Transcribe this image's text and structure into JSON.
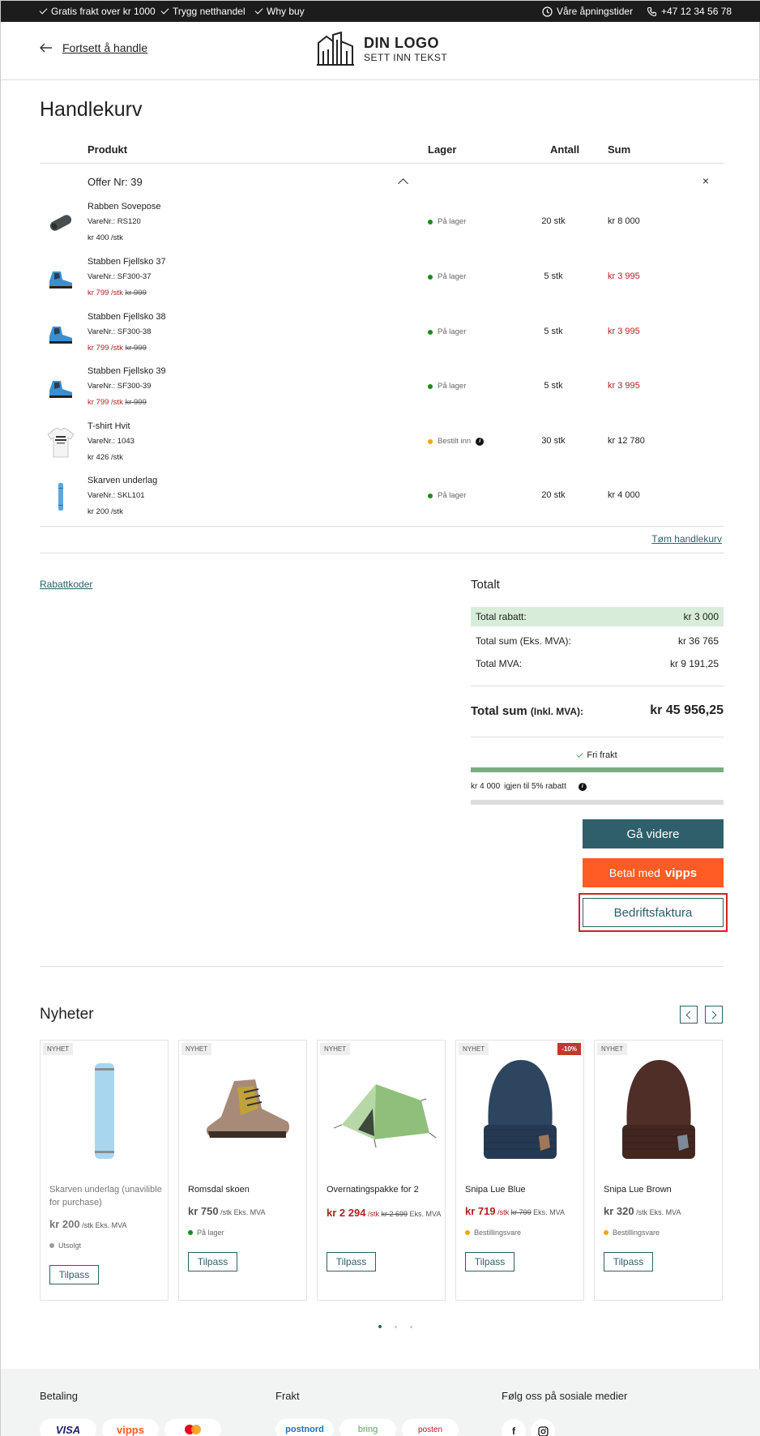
{
  "topbar": {
    "usp1": "Gratis frakt over kr 1000",
    "usp2": "Trygg netthandel",
    "usp3": "Why buy",
    "hours": "Våre åpningstider",
    "phone": "+47 12 34 56 78"
  },
  "header": {
    "back_label": "Fortsett å handle",
    "logo_line1": "DIN LOGO",
    "logo_line2": "SETT INN TEKST"
  },
  "cart": {
    "title": "Handlekurv",
    "columns": {
      "product": "Produkt",
      "stock": "Lager",
      "qty": "Antall",
      "sum": "Sum"
    },
    "offer_label": "Offer Nr: 39",
    "close_glyph": "×",
    "clear_label": "Tøm handlekurv",
    "items": [
      {
        "name": "Rabben Sovepose",
        "sku": "VareNr.: RS120",
        "price": "kr 400 /stk",
        "old_price": "",
        "stock": "På lager",
        "qty": "20 stk",
        "sum": "kr 8 000"
      },
      {
        "name": "Stabben Fjellsko 37",
        "sku": "VareNr.: SF300-37",
        "price": "kr 799 /stk",
        "old_price": "kr 999",
        "stock": "På lager",
        "qty": "5 stk",
        "sum": "kr 3 995"
      },
      {
        "name": "Stabben Fjellsko 38",
        "sku": "VareNr.: SF300-38",
        "price": "kr 799 /stk",
        "old_price": "kr 999",
        "stock": "På lager",
        "qty": "5 stk",
        "sum": "kr 3 995"
      },
      {
        "name": "Stabben Fjellsko 39",
        "sku": "VareNr.: SF300-39",
        "price": "kr 799 /stk",
        "old_price": "kr 999",
        "stock": "På lager",
        "qty": "5 stk",
        "sum": "kr 3 995"
      },
      {
        "name": "T-shirt Hvit",
        "sku": "VareNr.: 1043",
        "price": "kr 426 /stk",
        "old_price": "",
        "stock": "Bestilt inn",
        "qty": "30 stk",
        "sum": "kr 12 780"
      },
      {
        "name": "Skarven underlag",
        "sku": "VareNr.: SKL101",
        "price": "kr 200 /stk",
        "old_price": "",
        "stock": "På lager",
        "qty": "20 stk",
        "sum": "kr 4 000"
      }
    ]
  },
  "discount_link": "Rabattkoder",
  "totals": {
    "title": "Totalt",
    "discount_label": "Total rabatt:",
    "discount_value": "kr 3 000",
    "ex_vat_label": "Total sum (Eks. MVA):",
    "ex_vat_value": "kr 36 765",
    "vat_label": "Total MVA:",
    "vat_value": "kr 9 191,25",
    "grand_label": "Total sum",
    "grand_suffix": "(Inkl. MVA):",
    "grand_value": "kr 45 956,25",
    "free_shipping": "Fri frakt",
    "free_shipping_progress": 1.0,
    "discount_progress_amount": "kr 4 000",
    "discount_progress_text": "igjen til 5% rabatt",
    "discount_progress": 0.0
  },
  "buttons": {
    "continue": "Gå videre",
    "vipps_prefix": "Betal med",
    "vipps_brand": "vipps",
    "invoice": "Bedriftsfaktura"
  },
  "news": {
    "title": "Nyheter",
    "cards": [
      {
        "badge": "NYHET",
        "discount": "",
        "name": "Skarven underlag (unavilible for purchase)",
        "price": "kr 200",
        "unit": "/stk",
        "vat": "Eks. MVA",
        "old_price": "",
        "stock": "Utsolgt",
        "button": "Tilpass"
      },
      {
        "badge": "NYHET",
        "discount": "",
        "name": "Romsdal skoen",
        "price": "kr 750",
        "unit": "/stk",
        "vat": "Eks. MVA",
        "old_price": "",
        "stock": "På lager",
        "button": "Tilpass"
      },
      {
        "badge": "NYHET",
        "discount": "",
        "name": "Overnatingspakke for 2",
        "price": "kr 2 294",
        "unit": "/stk",
        "vat": "Eks. MVA",
        "old_price": "kr 2 699",
        "stock": "",
        "button": "Tilpass"
      },
      {
        "badge": "NYHET",
        "discount": "-10%",
        "name": "Snipa Lue Blue",
        "price": "kr 719",
        "unit": "/stk",
        "vat": "Eks. MVA",
        "old_price": "kr 799",
        "stock": "Bestillingsvare",
        "button": "Tilpass"
      },
      {
        "badge": "NYHET",
        "discount": "",
        "name": "Snipa Lue Brown",
        "price": "kr 320",
        "unit": "/stk",
        "vat": "Eks. MVA",
        "old_price": "",
        "stock": "Bestillingsvare",
        "button": "Tilpass"
      }
    ]
  },
  "footer": {
    "payment_title": "Betaling",
    "shipping_title": "Frakt",
    "social_title": "Følg oss på sosiale medier",
    "payment_logos": [
      "VISA",
      "vipps",
      "mastercard"
    ],
    "shipping_logos": [
      "postnord",
      "bring",
      "posten"
    ],
    "social_icons": [
      "f",
      "instagram"
    ]
  },
  "colors": {
    "accent": "#2e5f6a",
    "vipps": "#ff5b24",
    "sale": "#b22222",
    "in_stock": "#1a8a1a",
    "ordered": "#f0a800",
    "out": "#999999"
  }
}
